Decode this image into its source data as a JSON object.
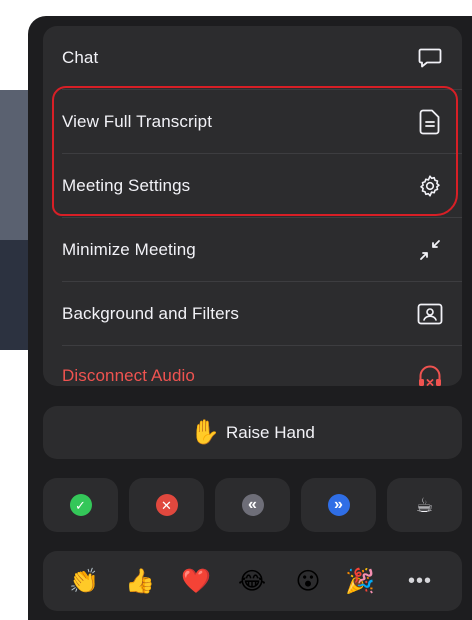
{
  "menu": {
    "items": [
      {
        "label": "Chat",
        "icon": "chat-bubble-icon"
      },
      {
        "label": "View Full Transcript",
        "icon": "document-icon"
      },
      {
        "label": "Meeting Settings",
        "icon": "gear-icon"
      },
      {
        "label": "Minimize Meeting",
        "icon": "minimize-arrows-icon"
      },
      {
        "label": "Background and Filters",
        "icon": "portrait-frame-icon"
      },
      {
        "label": "Disconnect Audio",
        "icon": "headphones-x-icon"
      }
    ]
  },
  "raise_hand": {
    "label": "Raise Hand",
    "emoji": "✋"
  },
  "status_buttons": [
    {
      "name": "yes",
      "glyph": "✓",
      "color": "#34c759"
    },
    {
      "name": "no",
      "glyph": "✕",
      "color": "#e0483e"
    },
    {
      "name": "slow-down",
      "glyph": "«",
      "color": "#6e6e78"
    },
    {
      "name": "speed-up",
      "glyph": "»",
      "color": "#2f6ee6"
    },
    {
      "name": "coffee",
      "glyph": "☕"
    }
  ],
  "reactions": [
    "👏",
    "👍",
    "❤️",
    "😂",
    "😮",
    "🎉"
  ],
  "more_label": "•••",
  "colors": {
    "sheet": "#1d1d1f",
    "card": "#2c2c2e",
    "text": "#f2f2f7",
    "danger": "#ef5350",
    "highlight": "#d81f26"
  }
}
